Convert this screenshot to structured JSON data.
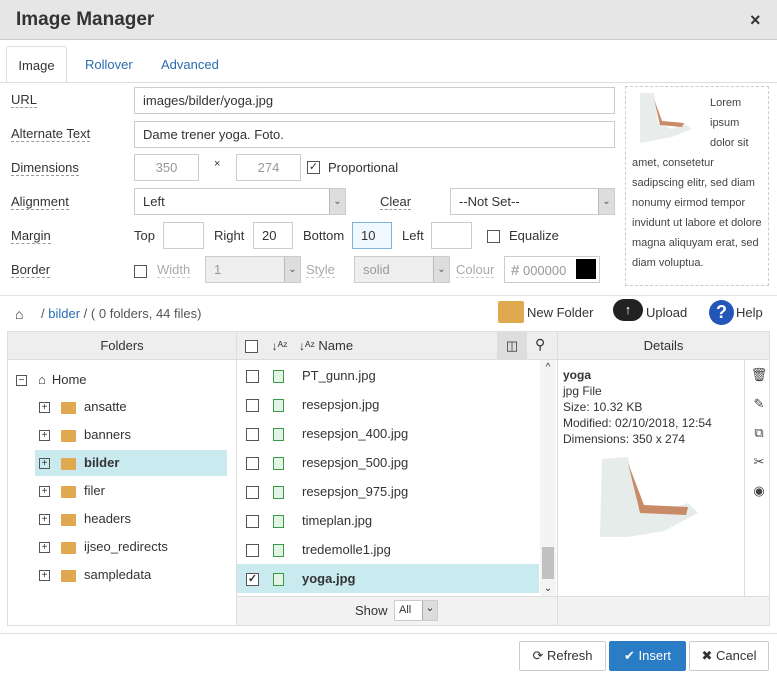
{
  "dialog": {
    "title": "Image Manager",
    "close": "×"
  },
  "tabs": [
    "Image",
    "Rollover",
    "Advanced"
  ],
  "form": {
    "url_label": "URL",
    "url_value": "images/bilder/yoga.jpg",
    "alt_label": "Alternate Text",
    "alt_value": "Dame trener yoga. Foto.",
    "dimensions_label": "Dimensions",
    "width": "350",
    "height": "274",
    "times": "×",
    "proportional_label": "Proportional",
    "proportional_checked": true,
    "alignment_label": "Alignment",
    "alignment_value": "Left",
    "clear_label": "Clear",
    "clear_value": "--Not Set--",
    "margin_label": "Margin",
    "top_label": "Top",
    "top_value": "",
    "right_label": "Right",
    "right_value": "20",
    "bottom_label": "Bottom",
    "bottom_value": "10",
    "left_label": "Left",
    "left_value": "",
    "equalize_label": "Equalize",
    "border_label": "Border",
    "border_width_label": "Width",
    "border_width_value": "1",
    "border_style_label": "Style",
    "border_style_value": "solid",
    "border_colour_label": "Colour",
    "border_colour_value": "000000",
    "border_colour_hash": "#"
  },
  "preview_text": {
    "first": "Lorem ipsum dolor sit",
    "rest": "amet, consetetur sadipscing elitr, sed diam nonumy eirmod tempor invidunt ut labore et dolore magna aliquyam erat, sed diam voluptua."
  },
  "breadcrumb": {
    "folder": "bilder",
    "sep": "/",
    "info": "( 0 folders, 44 files)"
  },
  "toolbar": {
    "new_folder": "New Folder",
    "upload": "Upload",
    "help": "Help"
  },
  "folders": {
    "header": "Folders",
    "root": "Home",
    "items": [
      "ansatte",
      "banners",
      "bilder",
      "filer",
      "headers",
      "ijseo_redirects",
      "sampledata"
    ],
    "selected": "bilder"
  },
  "files": {
    "name_header": "Name",
    "items": [
      "PT_gunn.jpg",
      "resepsjon.jpg",
      "resepsjon_400.jpg",
      "resepsjon_500.jpg",
      "resepsjon_975.jpg",
      "timeplan.jpg",
      "tredemolle1.jpg",
      "yoga.jpg"
    ],
    "selected": "yoga.jpg",
    "show_label": "Show",
    "show_value": "All"
  },
  "details": {
    "header": "Details",
    "name": "yoga",
    "type": "jpg File",
    "size": "Size: 10.32 KB",
    "modified": "Modified: 02/10/2018, 12:54",
    "dimensions": "Dimensions: 350 x 274"
  },
  "buttons": {
    "refresh": "Refresh",
    "insert": "Insert",
    "cancel": "Cancel"
  },
  "colors": {
    "accent": "#2a7dc4",
    "selection": "#c9ebf0",
    "folder": "#e0a84f"
  }
}
